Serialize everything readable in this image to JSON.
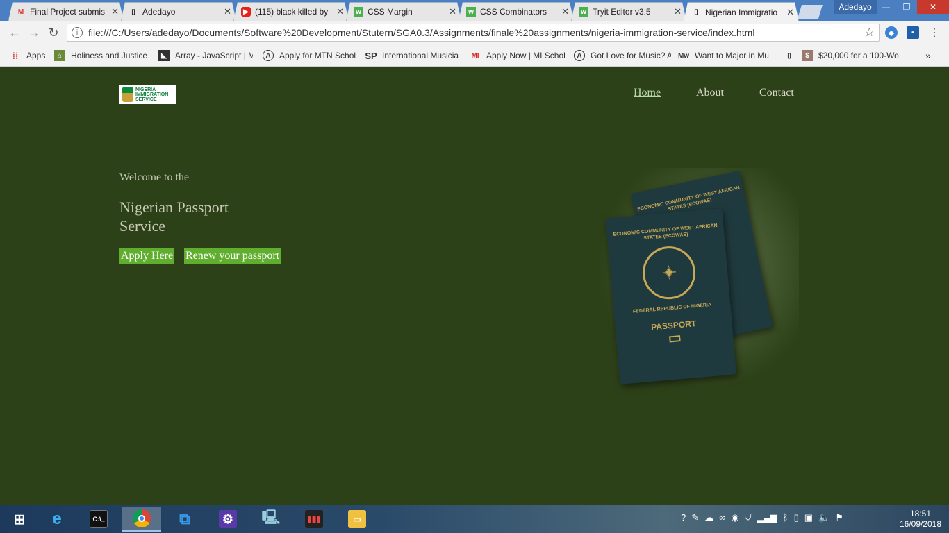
{
  "browser": {
    "tabs": [
      {
        "title": "Final Project submis",
        "icon": "gmail-icon"
      },
      {
        "title": "Adedayo",
        "icon": "page-icon"
      },
      {
        "title": "(115) black killed by",
        "icon": "youtube-icon"
      },
      {
        "title": "CSS Margin",
        "icon": "w3schools-icon"
      },
      {
        "title": "CSS Combinators",
        "icon": "w3schools-icon"
      },
      {
        "title": "Tryit Editor v3.5",
        "icon": "w3schools-icon"
      },
      {
        "title": "Nigerian Immigratio",
        "icon": "page-icon"
      }
    ],
    "profile_name": "Adedayo",
    "url": "file:///C:/Users/adedayo/Documents/Software%20Development/Stutern/SGA0.3/Assignments/finale%20assignments/nigeria-immigration-service/index.html",
    "bookmarks": [
      {
        "label": "Apps"
      },
      {
        "label": "Holiness and Justice I"
      },
      {
        "label": "Array - JavaScript | M"
      },
      {
        "label": "Apply for MTN Schol"
      },
      {
        "label": "International Musicia"
      },
      {
        "label": "Apply Now | MI Schol"
      },
      {
        "label": "Got Love for Music? A"
      },
      {
        "label": "Want to Major in Mu"
      },
      {
        "label": ""
      },
      {
        "label": "$20,000 for a 100-Wo"
      }
    ],
    "overflow": "»"
  },
  "site": {
    "logo_text": [
      "NIGERIA",
      "IMMIGRATION",
      "SERVICE"
    ],
    "nav": {
      "home": "Home",
      "about": "About",
      "contact": "Contact"
    },
    "welcome": "Welcome to the",
    "headline": "Nigerian Passport Service",
    "buttons": {
      "apply": "Apply Here",
      "renew": "Renew your passport"
    },
    "passport": {
      "ecowas": "ECONOMIC COMMUNITY OF WEST AFRICAN STATES (ECOWAS)",
      "federal": "FEDERAL REPUBLIC OF NIGERIA",
      "word": "PASSPORT"
    }
  },
  "taskbar": {
    "clock_time": "18:51",
    "clock_date": "16/09/2018"
  },
  "colors": {
    "page_bg": "#2d4119",
    "button_bg": "#5fae2e",
    "text": "#c9cbb8"
  }
}
